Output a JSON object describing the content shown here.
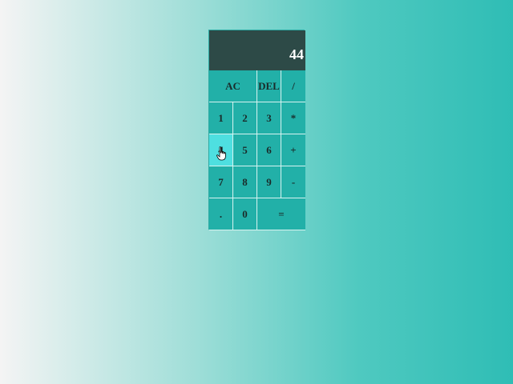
{
  "calculator": {
    "display": "44",
    "keys": [
      {
        "label": "AC",
        "name": "key-clear"
      },
      {
        "label": "DEL",
        "name": "key-delete"
      },
      {
        "label": "/",
        "name": "key-divide"
      },
      {
        "label": "1",
        "name": "key-1"
      },
      {
        "label": "2",
        "name": "key-2"
      },
      {
        "label": "3",
        "name": "key-3"
      },
      {
        "label": "*",
        "name": "key-multiply"
      },
      {
        "label": "4",
        "name": "key-4"
      },
      {
        "label": "5",
        "name": "key-5"
      },
      {
        "label": "6",
        "name": "key-6"
      },
      {
        "label": "+",
        "name": "key-add"
      },
      {
        "label": "7",
        "name": "key-7"
      },
      {
        "label": "8",
        "name": "key-8"
      },
      {
        "label": "9",
        "name": "key-9"
      },
      {
        "label": "-",
        "name": "key-subtract"
      },
      {
        "label": ".",
        "name": "key-decimal"
      },
      {
        "label": "0",
        "name": "key-0"
      },
      {
        "label": "=",
        "name": "key-equals"
      }
    ]
  },
  "colors": {
    "display_bg": "#2d4a47",
    "key_bg": "#22b0a8",
    "key_hover": "#4edfe0"
  },
  "cursor": {
    "icon": "hand-pointer-icon"
  }
}
